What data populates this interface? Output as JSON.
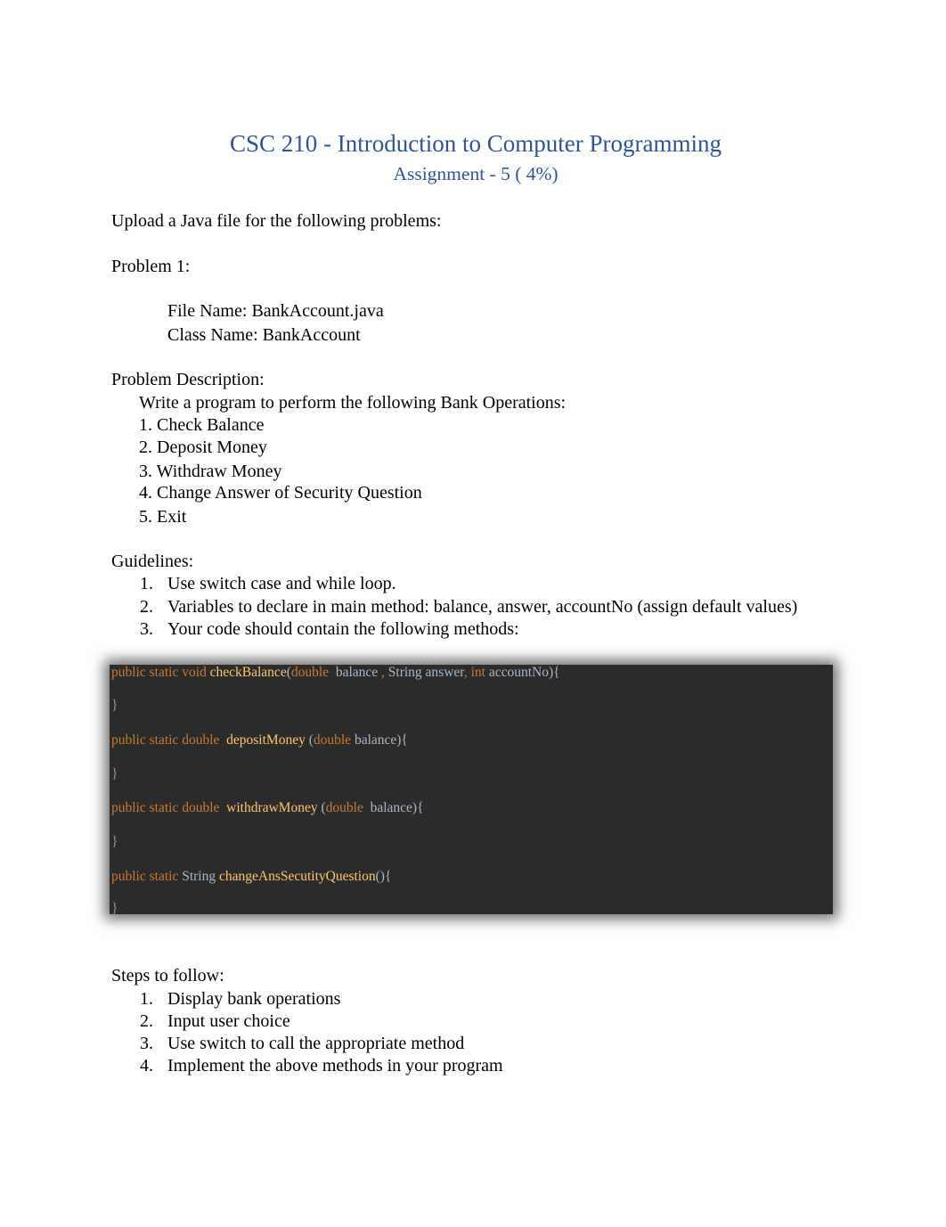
{
  "header": {
    "title": "CSC 210 - Introduction to Computer Programming",
    "subtitle": "Assignment - 5 ( 4%)"
  },
  "intro": "Upload  a Java file for the following problems:",
  "problem": {
    "heading": "Problem 1:",
    "file_name_label": "File Name:",
    "file_name_value": "BankAccount.java",
    "class_name_label": "Class Name:",
    "class_name_value": "BankAccount"
  },
  "description": {
    "heading": "Problem Description:",
    "lead": "Write a program to perform the following Bank Operations:",
    "operations": [
      "1. Check Balance",
      "2. Deposit Money",
      "3. Withdraw Money",
      "4. Change Answer of Security Question",
      "5. Exit"
    ]
  },
  "guidelines": {
    "heading": "Guidelines:",
    "items": [
      {
        "num": "1.",
        "text": "Use switch case and while loop."
      },
      {
        "num": "2.",
        "text": "Variables to declare in main method: balance, answer, accountNo (assign default values)"
      },
      {
        "num": "3.",
        "text": "Your code should contain the following methods:"
      }
    ]
  },
  "code": {
    "colors": {
      "background": "#2b2b2b",
      "keyword": "#cc7832",
      "method": "#ffc66d",
      "identifier": "#a9b7c6"
    },
    "lines": [
      {
        "tokens": [
          {
            "t": "public static void ",
            "c": "kw"
          },
          {
            "t": "checkBalance",
            "c": "fn"
          },
          {
            "t": "(",
            "c": "id"
          },
          {
            "t": "double ",
            "c": "kw"
          },
          {
            "t": " balance ",
            "c": "id"
          },
          {
            "t": ",",
            "c": "kw"
          },
          {
            "t": " String answer",
            "c": "id"
          },
          {
            "t": ",",
            "c": "kw"
          },
          {
            "t": " int",
            "c": "kw"
          },
          {
            "t": " accountNo){",
            "c": "id"
          }
        ]
      },
      {
        "tokens": [
          {
            "t": "}",
            "c": "br"
          }
        ]
      },
      {
        "tokens": [
          {
            "t": "public static double ",
            "c": "kw"
          },
          {
            "t": " depositMoney",
            "c": "fn"
          },
          {
            "t": " (",
            "c": "id"
          },
          {
            "t": "double",
            "c": "kw"
          },
          {
            "t": " balance){",
            "c": "id"
          }
        ]
      },
      {
        "tokens": [
          {
            "t": "}",
            "c": "br"
          }
        ]
      },
      {
        "tokens": [
          {
            "t": "public static double ",
            "c": "kw"
          },
          {
            "t": " withdrawMoney",
            "c": "fn"
          },
          {
            "t": " (",
            "c": "id"
          },
          {
            "t": "double ",
            "c": "kw"
          },
          {
            "t": " balance){",
            "c": "id"
          }
        ]
      },
      {
        "tokens": [
          {
            "t": "}",
            "c": "br"
          }
        ]
      },
      {
        "tokens": [
          {
            "t": "public static ",
            "c": "kw"
          },
          {
            "t": "String ",
            "c": "id"
          },
          {
            "t": "changeAnsSecutityQuestion",
            "c": "fn"
          },
          {
            "t": "(){",
            "c": "id"
          }
        ]
      },
      {
        "tokens": [
          {
            "t": "}",
            "c": "br"
          }
        ]
      }
    ]
  },
  "steps": {
    "heading": "Steps to follow:",
    "items": [
      {
        "num": "1.",
        "text": "Display bank operations"
      },
      {
        "num": "2.",
        "text": "Input user choice"
      },
      {
        "num": "3.",
        "text": "Use switch to call the appropriate method"
      },
      {
        "num": "4.",
        "text": "Implement the above methods in your program"
      }
    ]
  }
}
